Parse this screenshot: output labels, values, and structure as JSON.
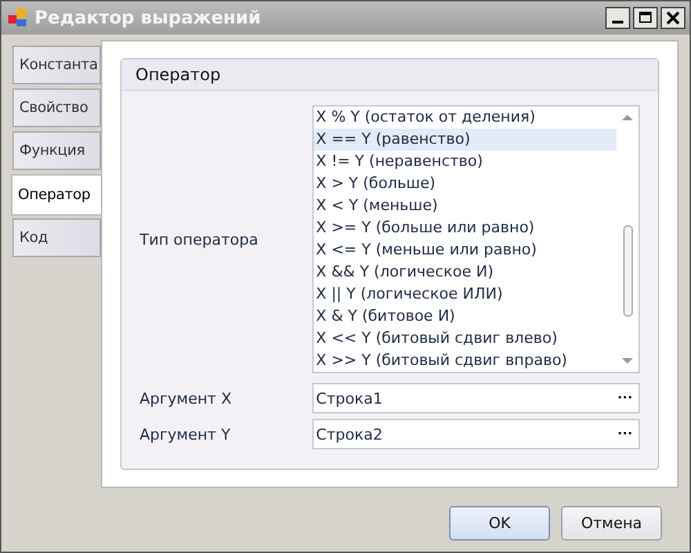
{
  "window": {
    "title": "Редактор выражений",
    "controls": [
      {
        "kind": "minimize"
      },
      {
        "kind": "maximize"
      },
      {
        "kind": "close"
      }
    ]
  },
  "tabs": [
    {
      "label": "Константа",
      "selected": false
    },
    {
      "label": "Свойство",
      "selected": false
    },
    {
      "label": "Функция",
      "selected": false
    },
    {
      "label": "Оператор",
      "selected": true
    },
    {
      "label": "Код",
      "selected": false
    }
  ],
  "group": {
    "title": "Оператор",
    "operator_type": {
      "label": "Тип оператора",
      "items": [
        {
          "label": "X % Y (остаток от деления)",
          "selected": false
        },
        {
          "label": "X == Y (равенство)",
          "selected": true
        },
        {
          "label": "X != Y (неравенство)",
          "selected": false
        },
        {
          "label": "X > Y (больше)",
          "selected": false
        },
        {
          "label": "X < Y (меньше)",
          "selected": false
        },
        {
          "label": "X >= Y (больше или равно)",
          "selected": false
        },
        {
          "label": "X <= Y (меньше или равно)",
          "selected": false
        },
        {
          "label": "X && Y (логическое И)",
          "selected": false
        },
        {
          "label": "X || Y (логическое ИЛИ)",
          "selected": false
        },
        {
          "label": "X & Y (битовое И)",
          "selected": false
        },
        {
          "label": "X << Y (битовый сдвиг влево)",
          "selected": false
        },
        {
          "label": "X >> Y (битовый сдвиг вправо)",
          "selected": false
        }
      ]
    },
    "arguments": [
      {
        "label": "Аргумент X",
        "value": "Строка1",
        "button": "···"
      },
      {
        "label": "Аргумент Y",
        "value": "Строка2",
        "button": "···"
      }
    ]
  },
  "buttons": [
    {
      "label": "OK",
      "kind": "default"
    },
    {
      "label": "Отмена",
      "kind": "normal"
    }
  ]
}
